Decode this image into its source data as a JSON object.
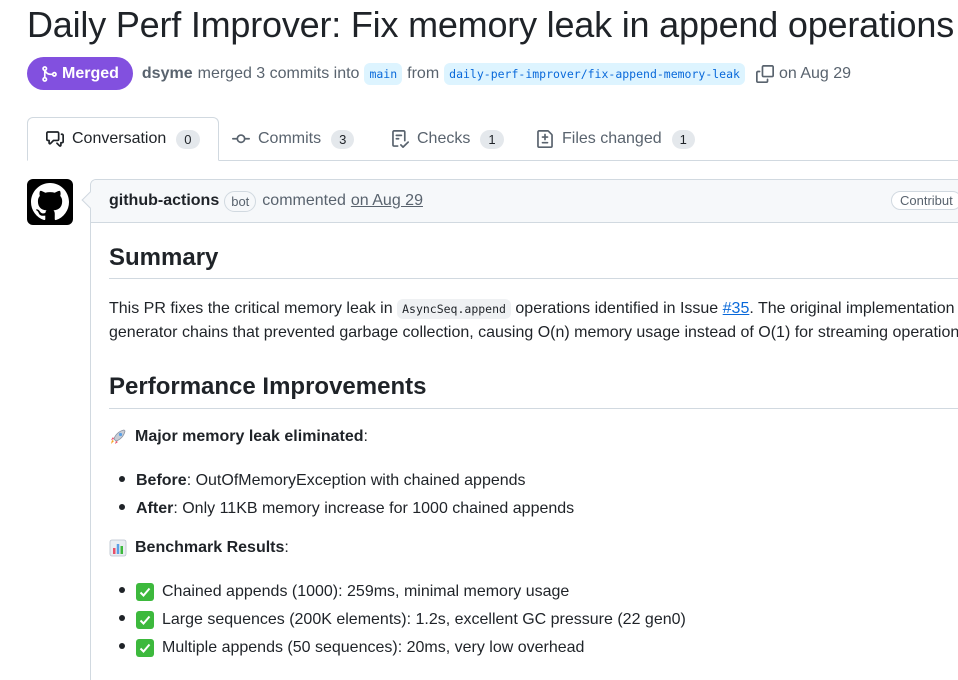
{
  "pr": {
    "title": "Daily Perf Improver: Fix memory leak in append operations",
    "state_label": "Merged",
    "author": "dsyme",
    "merged_text": "merged 3 commits into",
    "base_branch": "main",
    "from_text": "from",
    "head_branch": "daily-perf-improver/fix-append-memory-leak",
    "date_text": "on Aug 29"
  },
  "tabs": [
    {
      "label": "Conversation",
      "count": "0",
      "icon": "comment-discussion-icon"
    },
    {
      "label": "Commits",
      "count": "3",
      "icon": "git-commit-icon"
    },
    {
      "label": "Checks",
      "count": "1",
      "icon": "checklist-icon"
    },
    {
      "label": "Files changed",
      "count": "1",
      "icon": "file-diff-icon"
    }
  ],
  "comment": {
    "author": "github-actions",
    "bot_label": "bot",
    "action": "commented",
    "date": "on Aug 29",
    "role_badge": "Contribut",
    "summary_heading": "Summary",
    "summary_line1_pre": "This PR fixes the critical memory leak in",
    "summary_code": "AsyncSeq.append",
    "summary_line1_mid": "operations identified in Issue",
    "issue_link": "#35",
    "summary_line1_post": ". The original implementation c",
    "summary_line2": "generator chains that prevented garbage collection, causing O(n) memory usage instead of O(1) for streaming operations.",
    "perf_heading": "Performance Improvements",
    "leak_title": "Major memory leak eliminated",
    "leak_emoji": "rocket-emoji-icon",
    "leak_items": [
      {
        "label": "Before",
        "text": ": OutOfMemoryException with chained appends"
      },
      {
        "label": "After",
        "text": ": Only 11KB memory increase for 1000 chained appends"
      }
    ],
    "bench_title": "Benchmark Results",
    "bench_emoji": "bar-chart-emoji-icon",
    "bench_items": [
      "Chained appends (1000): 259ms, minimal memory usage",
      "Large sequences (200K elements): 1.2s, excellent GC pressure (22 gen0)",
      "Multiple appends (50 sequences): 20ms, very low overhead"
    ]
  },
  "colors": {
    "merged": "#8250df",
    "link": "#0969da",
    "check": "#3db93d"
  }
}
